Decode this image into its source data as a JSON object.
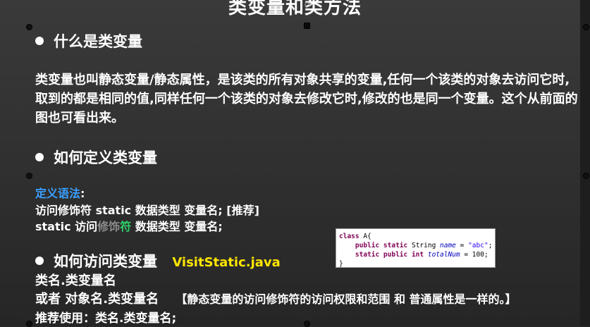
{
  "slide": {
    "title": "类变量和类方法",
    "section1": {
      "heading": "什么是类变量",
      "paragraph": "类变量也叫静态变量/静态属性，是该类的所有对象共享的变量,任何一个该类的对象去访问它时,取到的都是相同的值,同样任何一个该类的对象去修改它时,修改的也是同一个变量。这个从前面的图也可看出来。"
    },
    "section2": {
      "heading": "如何定义类变量",
      "syntax_label": "定义语法",
      "syntax_colon": ":",
      "line1": "访问修饰符 static 数据类型 变量名; [推荐]",
      "line2_a": "static 访问",
      "line2_b": "修饰",
      "line2_c": "符",
      "line2_d": " 数据类型 变量名;"
    },
    "code": {
      "l1_kw": "class",
      "l1_rest": " A{",
      "l2_kw": "public static",
      "l2_type": " String ",
      "l2_field": "name",
      "l2_eq": " = ",
      "l2_str": "\"abc\"",
      "l2_end": ";",
      "l3_kw": "static public int",
      "l3_field": "totalNum",
      "l3_rest": " = 100;",
      "l4": "}"
    },
    "section3": {
      "heading": "如何访问类变量",
      "file": "VisitStatic.java",
      "line1": "类名.类变量名",
      "line2": "或者 对象名.类变量名",
      "note": "【静态变量的访问修饰符的访问权限和范围 和 普通属性是一样的。】",
      "line3": "推荐使用：类名.类变量名;"
    }
  }
}
